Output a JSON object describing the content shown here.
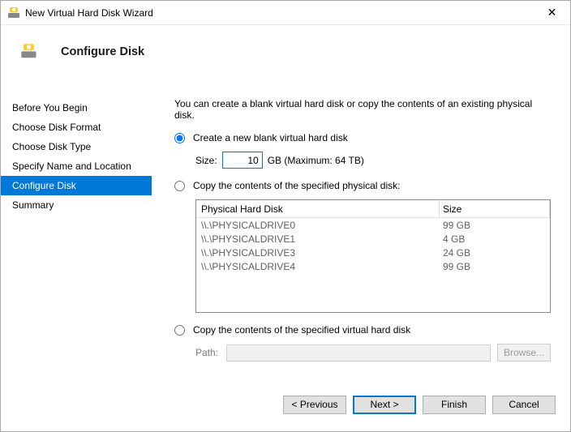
{
  "window": {
    "title": "New Virtual Hard Disk Wizard",
    "close_glyph": "✕"
  },
  "header": {
    "title": "Configure Disk"
  },
  "sidebar": {
    "items": [
      {
        "label": "Before You Begin"
      },
      {
        "label": "Choose Disk Format"
      },
      {
        "label": "Choose Disk Type"
      },
      {
        "label": "Specify Name and Location"
      },
      {
        "label": "Configure Disk"
      },
      {
        "label": "Summary"
      }
    ],
    "active_index": 4
  },
  "main": {
    "intro": "You can create a blank virtual hard disk or copy the contents of an existing physical disk.",
    "opt1_label": "Create a new blank virtual hard disk",
    "size_label": "Size:",
    "size_value": "10",
    "size_suffix": "GB (Maximum: 64 TB)",
    "opt2_label": "Copy the contents of the specified physical disk:",
    "table": {
      "col1": "Physical Hard Disk",
      "col2": "Size",
      "rows": [
        {
          "name": "\\\\.\\PHYSICALDRIVE0",
          "size": "99 GB"
        },
        {
          "name": "\\\\.\\PHYSICALDRIVE1",
          "size": "4 GB"
        },
        {
          "name": "\\\\.\\PHYSICALDRIVE3",
          "size": "24 GB"
        },
        {
          "name": "\\\\.\\PHYSICALDRIVE4",
          "size": "99 GB"
        }
      ]
    },
    "opt3_label": "Copy the contents of the specified virtual hard disk",
    "path_label": "Path:",
    "browse_label": "Browse..."
  },
  "footer": {
    "previous": "< Previous",
    "next": "Next >",
    "finish": "Finish",
    "cancel": "Cancel"
  }
}
